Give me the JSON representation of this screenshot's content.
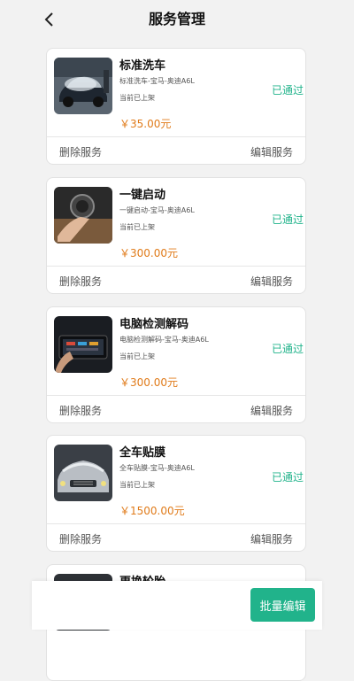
{
  "header": {
    "title": "服务管理"
  },
  "services": [
    {
      "title": "标准洗车",
      "desc": "标准洗车-宝马-奥迪A6L",
      "status": "当前已上架",
      "approval": "已通过",
      "price": "￥35.00元",
      "delete_label": "删除服务",
      "edit_label": "编辑服务"
    },
    {
      "title": "一键启动",
      "desc": "一键启动-宝马-奥迪A6L",
      "status": "当前已上架",
      "approval": "已通过",
      "price": "￥300.00元",
      "delete_label": "删除服务",
      "edit_label": "编辑服务"
    },
    {
      "title": "电脑检测解码",
      "desc": "电脑检测解码-宝马-奥迪A6L",
      "status": "当前已上架",
      "approval": "已通过",
      "price": "￥300.00元",
      "delete_label": "删除服务",
      "edit_label": "编辑服务"
    },
    {
      "title": "全车贴膜",
      "desc": "全车贴膜-宝马-奥迪A6L",
      "status": "当前已上架",
      "approval": "已通过",
      "price": "￥1500.00元",
      "delete_label": "删除服务",
      "edit_label": "编辑服务"
    },
    {
      "title": "更换轮胎"
    }
  ],
  "footer": {
    "batch_edit_label": "批量编辑"
  },
  "colors": {
    "accent": "#21b38b",
    "price": "#e07b1a"
  }
}
